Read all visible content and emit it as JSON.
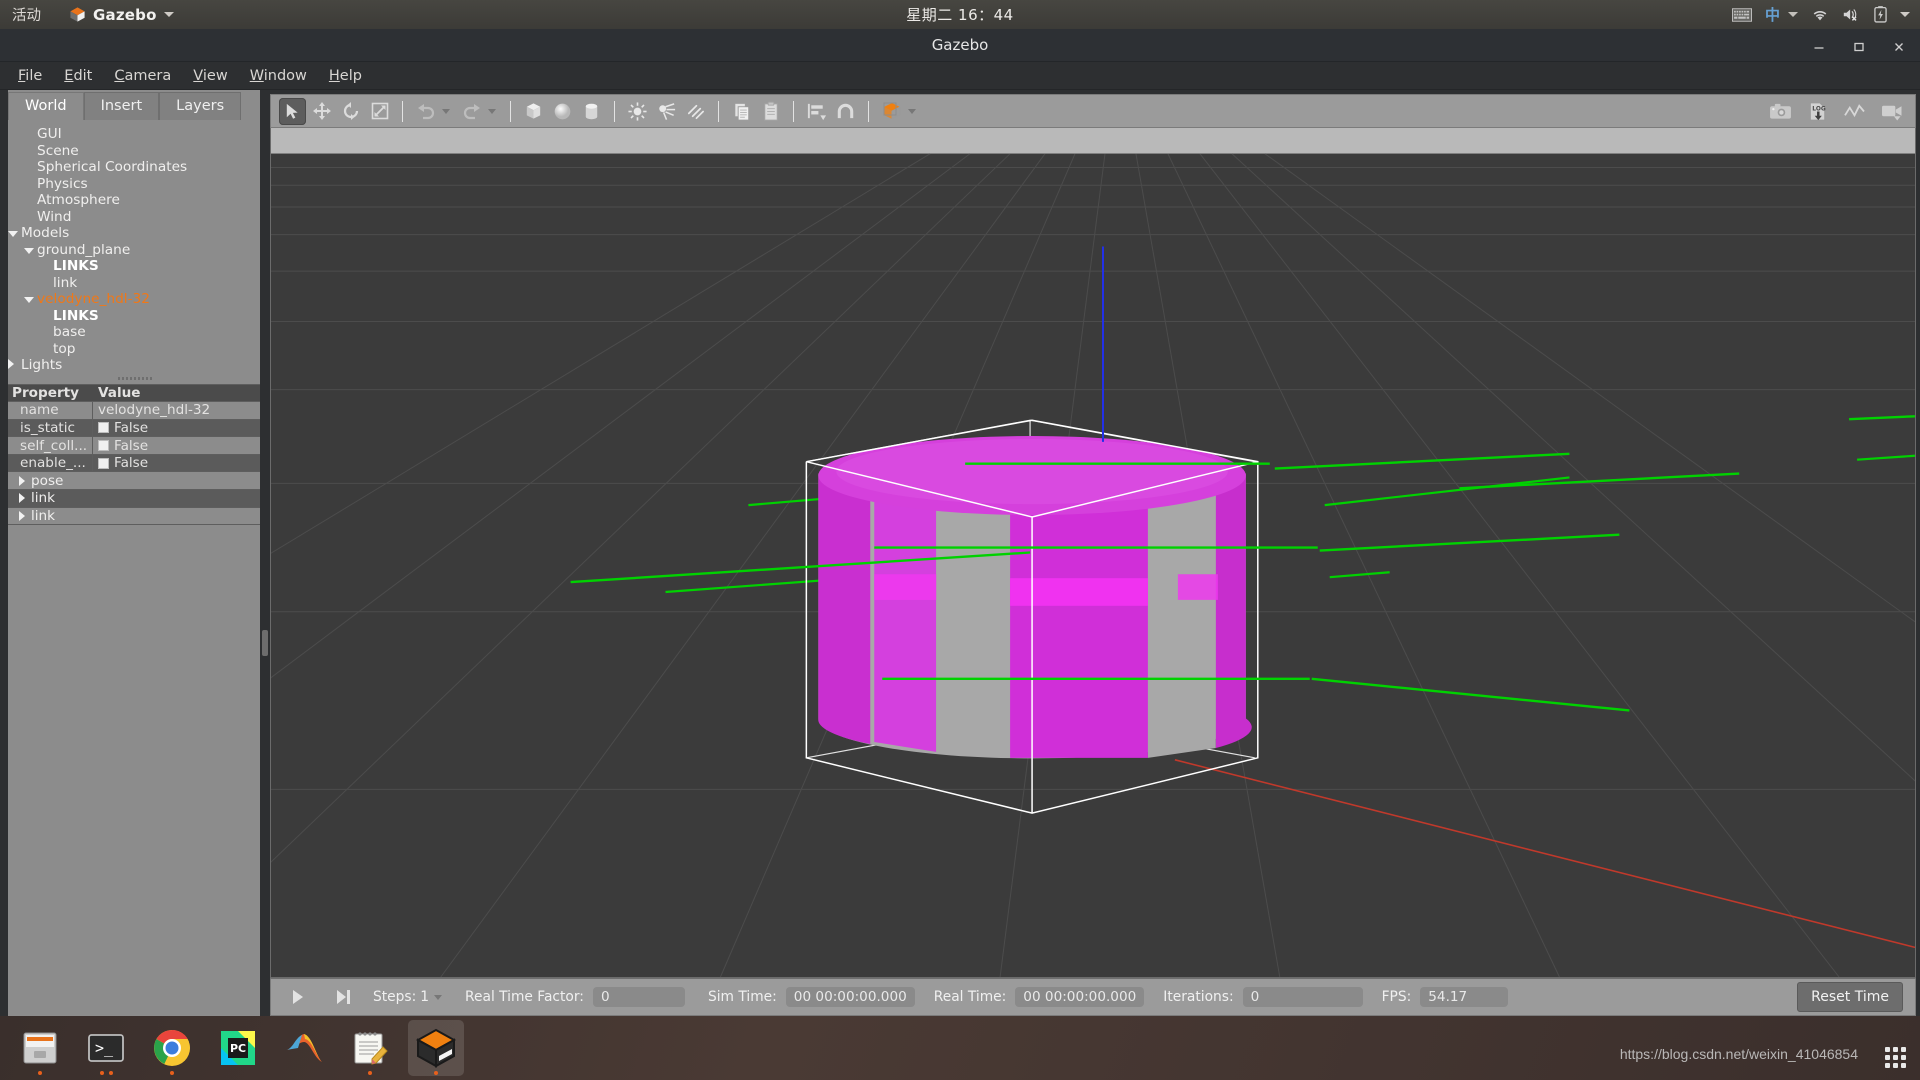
{
  "desktop": {
    "activities": "活动",
    "app_name": "Gazebo",
    "clock": "星期二 16：44",
    "tray_icons": [
      "keyboard-icon",
      "input-method-zh-icon",
      "wifi-icon",
      "volume-muted-icon",
      "battery-icon",
      "system-menu-caret-icon"
    ],
    "input_method_label": "中",
    "watermark": "https://blog.csdn.net/weixin_41046854"
  },
  "window": {
    "title": "Gazebo",
    "controls": [
      "minimize",
      "maximize",
      "close"
    ]
  },
  "menubar": {
    "items": [
      {
        "mnemonic": "F",
        "rest": "ile"
      },
      {
        "mnemonic": "E",
        "rest": "dit"
      },
      {
        "mnemonic": "C",
        "rest": "amera"
      },
      {
        "mnemonic": "V",
        "rest": "iew"
      },
      {
        "mnemonic": "W",
        "rest": "indow"
      },
      {
        "mnemonic": "H",
        "rest": "elp"
      }
    ]
  },
  "left_panel": {
    "tabs": [
      {
        "label": "World",
        "active": true
      },
      {
        "label": "Insert",
        "active": false
      },
      {
        "label": "Layers",
        "active": false
      }
    ],
    "tree": [
      {
        "label": "GUI",
        "indent": 1,
        "arrow": "none",
        "style": "normal"
      },
      {
        "label": "Scene",
        "indent": 1,
        "arrow": "none",
        "style": "normal"
      },
      {
        "label": "Spherical Coordinates",
        "indent": 1,
        "arrow": "none",
        "style": "normal"
      },
      {
        "label": "Physics",
        "indent": 1,
        "arrow": "none",
        "style": "normal"
      },
      {
        "label": "Atmosphere",
        "indent": 1,
        "arrow": "none",
        "style": "normal"
      },
      {
        "label": "Wind",
        "indent": 1,
        "arrow": "none",
        "style": "normal"
      },
      {
        "label": "Models",
        "indent": 0,
        "arrow": "down",
        "style": "normal"
      },
      {
        "label": "ground_plane",
        "indent": 1,
        "arrow": "down",
        "style": "normal"
      },
      {
        "label": "LINKS",
        "indent": 2,
        "arrow": "none",
        "style": "bold"
      },
      {
        "label": "link",
        "indent": 2,
        "arrow": "none",
        "style": "normal"
      },
      {
        "label": "velodyne_hdl-32",
        "indent": 1,
        "arrow": "down",
        "style": "selected"
      },
      {
        "label": "LINKS",
        "indent": 2,
        "arrow": "none",
        "style": "bold"
      },
      {
        "label": "base",
        "indent": 2,
        "arrow": "none",
        "style": "normal"
      },
      {
        "label": "top",
        "indent": 2,
        "arrow": "none",
        "style": "normal"
      },
      {
        "label": "Lights",
        "indent": 0,
        "arrow": "right",
        "style": "normal"
      }
    ],
    "property_table": {
      "headers": {
        "property": "Property",
        "value": "Value"
      },
      "rows": [
        {
          "key": "name",
          "value": "velodyne_hdl-32",
          "checkbox": false,
          "band": "plain"
        },
        {
          "key": "is_static",
          "value": "False",
          "checkbox": true,
          "band": "alt"
        },
        {
          "key": "self_coll...",
          "value": "False",
          "checkbox": true,
          "band": "plain"
        },
        {
          "key": "enable_...",
          "value": "False",
          "checkbox": true,
          "band": "alt"
        }
      ],
      "expandable": [
        {
          "label": "pose",
          "band": "plain"
        },
        {
          "label": "link",
          "band": "alt"
        },
        {
          "label": "link",
          "band": "plain"
        }
      ]
    }
  },
  "toolbar": {
    "left_tools": [
      {
        "name": "select-tool",
        "icon": "cursor-arrow-icon",
        "active": true
      },
      {
        "name": "translate-tool",
        "icon": "move-arrows-icon",
        "active": false
      },
      {
        "name": "rotate-tool",
        "icon": "rotate-icon",
        "active": false
      },
      {
        "name": "scale-tool",
        "icon": "scale-icon",
        "active": false
      }
    ],
    "history_tools": [
      {
        "name": "undo-button",
        "icon": "undo-arrow-icon",
        "has_caret": true
      },
      {
        "name": "redo-button",
        "icon": "redo-arrow-icon",
        "has_caret": true
      }
    ],
    "shape_tools": [
      {
        "name": "insert-box-button",
        "icon": "box-icon"
      },
      {
        "name": "insert-sphere-button",
        "icon": "sphere-icon"
      },
      {
        "name": "insert-cylinder-button",
        "icon": "cylinder-icon"
      }
    ],
    "light_tools": [
      {
        "name": "insert-point-light-button",
        "icon": "point-light-icon"
      },
      {
        "name": "insert-spot-light-button",
        "icon": "spot-light-icon"
      },
      {
        "name": "insert-directional-light-button",
        "icon": "directional-light-icon"
      }
    ],
    "clipboard_tools": [
      {
        "name": "copy-button",
        "icon": "copy-icon"
      },
      {
        "name": "paste-button",
        "icon": "paste-icon"
      }
    ],
    "align_tools": [
      {
        "name": "align-button",
        "icon": "align-icon",
        "has_caret": true
      },
      {
        "name": "snap-button",
        "icon": "magnet-snap-icon",
        "has_caret": false
      }
    ],
    "view_tools": [
      {
        "name": "view-angle-button",
        "icon": "orange-cube-icon",
        "has_caret": true
      }
    ],
    "right_tools": [
      {
        "name": "screenshot-button",
        "icon": "camera-icon"
      },
      {
        "name": "log-button",
        "icon": "log-download-icon",
        "label": "LOG"
      },
      {
        "name": "plot-button",
        "icon": "plot-line-icon"
      },
      {
        "name": "record-video-button",
        "icon": "video-camera-icon"
      }
    ]
  },
  "viewport": {
    "scene_name": "velodyne_hdl-32",
    "colors": {
      "sky": "#b9b9b9",
      "ground": "#3b3b3b",
      "grid_line": "#4a4a4a",
      "model_magenta": "#d42fd4",
      "model_gray": "#a8a8a8",
      "bbox_outline": "#ffffff",
      "laser_ray": "#00d000",
      "z_axis": "#2222ee",
      "x_axis": "#cc2222"
    }
  },
  "statusbar": {
    "play_button": "play-icon",
    "step_button": "step-forward-icon",
    "steps_label": "Steps:",
    "steps_value": "1",
    "real_time_factor_label": "Real Time Factor:",
    "real_time_factor_value": "0",
    "sim_time_label": "Sim Time:",
    "sim_time_value": "00 00:00:00.000",
    "real_time_label": "Real Time:",
    "real_time_value": "00 00:00:00.000",
    "iterations_label": "Iterations:",
    "iterations_value": "0",
    "fps_label": "FPS:",
    "fps_value": "54.17",
    "reset_button": "Reset Time"
  },
  "dock": {
    "items": [
      {
        "name": "files-app",
        "icon": "file-manager-icon",
        "dots": 1,
        "active": false
      },
      {
        "name": "terminal-app",
        "icon": "terminal-icon",
        "dots": 2,
        "active": false
      },
      {
        "name": "chrome-app",
        "icon": "chrome-icon",
        "dots": 1,
        "active": false
      },
      {
        "name": "pycharm-app",
        "icon": "pycharm-icon",
        "dots": 0,
        "active": false
      },
      {
        "name": "matlab-app",
        "icon": "matlab-icon",
        "dots": 0,
        "active": false
      },
      {
        "name": "text-editor-app",
        "icon": "notepad-icon",
        "dots": 1,
        "active": false
      },
      {
        "name": "gazebo-app",
        "icon": "gazebo-cube-icon",
        "dots": 1,
        "active": true
      }
    ],
    "show_apps": "app-grid-icon"
  }
}
